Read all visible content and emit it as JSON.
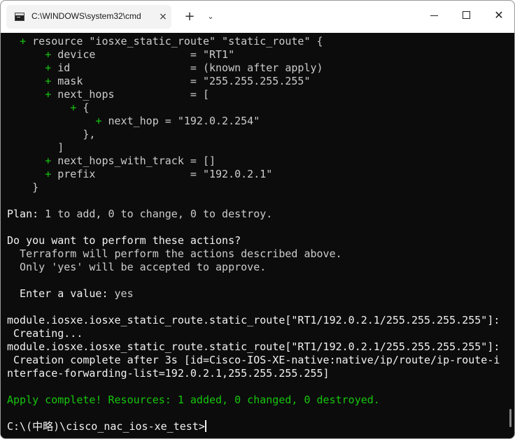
{
  "window": {
    "tab_title": "C:\\WINDOWS\\system32\\cmd",
    "tab_close": "×",
    "new_tab": "+",
    "dropdown": "⌄",
    "close": "✕"
  },
  "terminal": {
    "lines": [
      {
        "pre": "  ",
        "plus": "+",
        "text": " resource \"iosxe_static_route\" \"static_route\" {",
        "cls": ""
      },
      {
        "pre": "      ",
        "plus": "+",
        "text": " device               = \"RT1\"",
        "cls": ""
      },
      {
        "pre": "      ",
        "plus": "+",
        "text": " id                   = (known after apply)",
        "cls": ""
      },
      {
        "pre": "      ",
        "plus": "+",
        "text": " mask                 = \"255.255.255.255\"",
        "cls": ""
      },
      {
        "pre": "      ",
        "plus": "+",
        "text": " next_hops            = [",
        "cls": ""
      },
      {
        "pre": "          ",
        "plus": "+",
        "text": " {",
        "cls": ""
      },
      {
        "pre": "              ",
        "plus": "+",
        "text": " next_hop = \"192.0.2.254\"",
        "cls": ""
      },
      {
        "pre": "",
        "plus": "",
        "text": "            },",
        "cls": ""
      },
      {
        "pre": "",
        "plus": "",
        "text": "        ]",
        "cls": ""
      },
      {
        "pre": "      ",
        "plus": "+",
        "text": " next_hops_with_track = []",
        "cls": ""
      },
      {
        "pre": "      ",
        "plus": "+",
        "text": " prefix               = \"192.0.2.1\"",
        "cls": ""
      },
      {
        "pre": "",
        "plus": "",
        "text": "    }",
        "cls": ""
      },
      {
        "pre": "",
        "plus": "",
        "text": "",
        "cls": ""
      },
      {
        "pre": "",
        "plus": "",
        "text": "Plan: 1 to add, 0 to change, 0 to destroy.",
        "cls": "mixed-plan"
      },
      {
        "pre": "",
        "plus": "",
        "text": "",
        "cls": ""
      },
      {
        "pre": "",
        "plus": "",
        "text": "Do you want to perform these actions?",
        "cls": "white"
      },
      {
        "pre": "",
        "plus": "",
        "text": "  Terraform will perform the actions described above.",
        "cls": ""
      },
      {
        "pre": "",
        "plus": "",
        "text": "  Only 'yes' will be accepted to approve.",
        "cls": ""
      },
      {
        "pre": "",
        "plus": "",
        "text": "",
        "cls": ""
      },
      {
        "pre": "",
        "plus": "",
        "text": "  Enter a value: yes",
        "cls": "mixed-enter"
      },
      {
        "pre": "",
        "plus": "",
        "text": "",
        "cls": ""
      },
      {
        "pre": "",
        "plus": "",
        "text": "module.iosxe.iosxe_static_route.static_route[\"RT1/192.0.2.1/255.255.255.255\"]:",
        "cls": "white"
      },
      {
        "pre": "",
        "plus": "",
        "text": " Creating...",
        "cls": "white"
      },
      {
        "pre": "",
        "plus": "",
        "text": "module.iosxe.iosxe_static_route.static_route[\"RT1/192.0.2.1/255.255.255.255\"]:",
        "cls": "white"
      },
      {
        "pre": "",
        "plus": "",
        "text": " Creation complete after 3s [id=Cisco-IOS-XE-native:native/ip/route/ip-route-i",
        "cls": "white"
      },
      {
        "pre": "",
        "plus": "",
        "text": "nterface-forwarding-list=192.0.2.1,255.255.255.255]",
        "cls": "white"
      },
      {
        "pre": "",
        "plus": "",
        "text": "",
        "cls": ""
      },
      {
        "pre": "",
        "plus": "",
        "text": "Apply complete! Resources: 1 added, 0 changed, 0 destroyed.",
        "cls": "green"
      },
      {
        "pre": "",
        "plus": "",
        "text": "",
        "cls": ""
      },
      {
        "pre": "",
        "plus": "",
        "text": "C:\\(中略)\\cisco_nac_ios-xe_test>",
        "cls": "prompt"
      }
    ],
    "plan_label": "Plan:",
    "plan_rest": " 1 to add, 0 to change, 0 to destroy.",
    "enter_label": "  Enter a value:",
    "enter_value": " yes",
    "colors": {
      "text": "#cccccc",
      "bright": "#f2f2f2",
      "green": "#16c60c",
      "background": "#0c0c0c"
    }
  }
}
